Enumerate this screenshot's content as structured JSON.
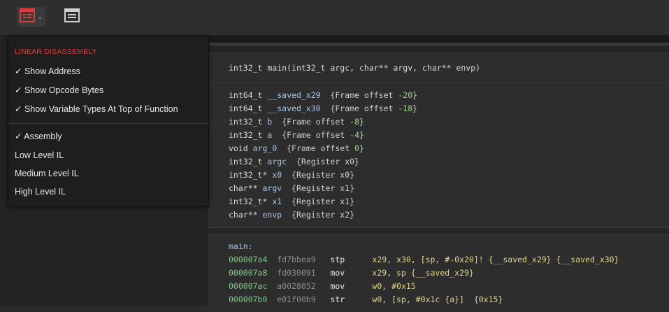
{
  "colors": {
    "accent_red": "#e23b3b",
    "code_green": "#9fd08e",
    "code_blue": "#a7c6e8",
    "address_green": "#83c487"
  },
  "toolbar": {
    "buttons": [
      {
        "icon": "linear-view-icon",
        "has_dropdown": true,
        "active": true
      },
      {
        "icon": "graph-view-icon",
        "has_dropdown": false,
        "active": false
      }
    ]
  },
  "menu": {
    "section_title": "LINEAR DISASSEMBLY",
    "options": [
      "✓ Show Address",
      "✓ Show Opcode Bytes",
      "✓ Show Variable Types At Top of Function"
    ],
    "il_levels": [
      "✓ Assembly",
      "Low Level IL",
      "Medium Level IL",
      "High Level IL"
    ]
  },
  "code": {
    "signature": {
      "ret": "int32_t",
      "name": "main",
      "params": "(int32_t argc, char** argv, char** envp)"
    },
    "variables": [
      {
        "type": "int64_t",
        "name": "__saved_x29",
        "info_pre": "{Frame offset ",
        "info_num": "-20",
        "info_post": "}"
      },
      {
        "type": "int64_t",
        "name": "__saved_x30",
        "info_pre": "{Frame offset ",
        "info_num": "-18",
        "info_post": "}"
      },
      {
        "type": "int32_t",
        "name": "b",
        "info_pre": "{Frame offset ",
        "info_num": "-8",
        "info_post": "}"
      },
      {
        "type": "int32_t",
        "name": "a",
        "info_pre": "{Frame offset ",
        "info_num": "-4",
        "info_post": "}"
      },
      {
        "type": "void",
        "name": "arg_0",
        "info_pre": "{Frame offset ",
        "info_num": "0",
        "info_post": "}"
      },
      {
        "type": "int32_t",
        "name": "argc",
        "info_pre": "{Register x0}",
        "info_num": "",
        "info_post": ""
      },
      {
        "type": "int32_t*",
        "name": "x0",
        "info_pre": "{Register x0}",
        "info_num": "",
        "info_post": ""
      },
      {
        "type": "char**",
        "name": "argv",
        "info_pre": "{Register x1}",
        "info_num": "",
        "info_post": ""
      },
      {
        "type": "int32_t*",
        "name": "x1",
        "info_pre": "{Register x1}",
        "info_num": "",
        "info_post": ""
      },
      {
        "type": "char**",
        "name": "envp",
        "info_pre": "{Register x2}",
        "info_num": "",
        "info_post": ""
      }
    ],
    "label": "main:",
    "instructions": [
      {
        "addr": "000007a4",
        "bytes": "fd7bbea9",
        "mnemonic": "stp",
        "operands": "x29, x30, [sp, #-0x20]! {__saved_x29} {__saved_x30}"
      },
      {
        "addr": "000007a8",
        "bytes": "fd030091",
        "mnemonic": "mov",
        "operands": "x29, sp {__saved_x29}"
      },
      {
        "addr": "000007ac",
        "bytes": "a0028052",
        "mnemonic": "mov",
        "operands": "w0, #0x15"
      },
      {
        "addr": "000007b0",
        "bytes": "e01f00b9",
        "mnemonic": "str",
        "operands": "w0, [sp, #0x1c {a}]  {0x15}"
      }
    ]
  }
}
